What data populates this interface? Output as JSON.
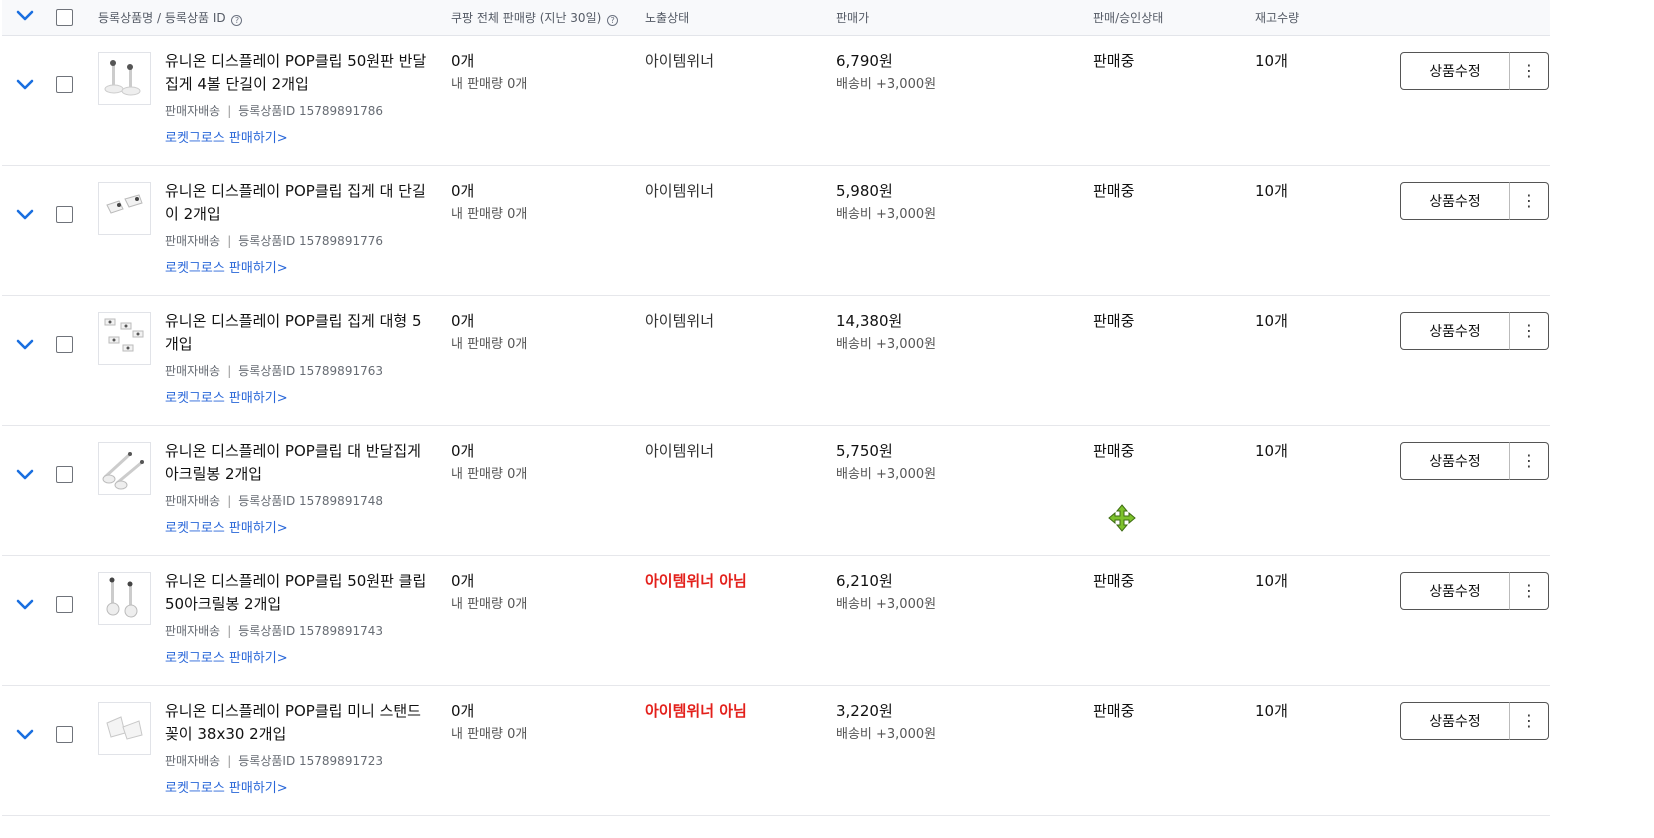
{
  "header": {
    "product_col": "등록상품명 / 등록상품 ID",
    "sales_col": "쿠팡 전체 판매량 (지난 30일)",
    "exposure_col": "노출상태",
    "price_col": "판매가",
    "status_col": "판매/승인상태",
    "stock_col": "재고수량",
    "help_glyph": "?"
  },
  "icons": {
    "expand": "chevron-down-icon",
    "more": "more-vertical-icon",
    "cursor": "move-cursor-icon"
  },
  "colors": {
    "link": "#2866d8",
    "not_winner": "#e3201b"
  },
  "common": {
    "shipping_type": "판매자배송",
    "separator": "|",
    "rocket_growth_link": "로켓그로스 판매하기>",
    "edit_label": "상품수정",
    "more_glyph": "⋮"
  },
  "rows": [
    {
      "name": "유니온 디스플레이 POP클립 50원판 반달집게 4볼 단길이 2개입",
      "reg_id": "등록상품ID 15789891786",
      "sales_total": "0개",
      "my_sales": "내 판매량 0개",
      "exposure": "아이템위너",
      "price": "6,790원",
      "shipping_fee": "배송비 +3,000원",
      "status": "판매중",
      "stock": "10개"
    },
    {
      "name": "유니온 디스플레이 POP클립 집게 대 단길이 2개입",
      "reg_id": "등록상품ID 15789891776",
      "sales_total": "0개",
      "my_sales": "내 판매량 0개",
      "exposure": "아이템위너",
      "price": "5,980원",
      "shipping_fee": "배송비 +3,000원",
      "status": "판매중",
      "stock": "10개"
    },
    {
      "name": "유니온 디스플레이 POP클립 집게 대형 5개입",
      "reg_id": "등록상품ID 15789891763",
      "sales_total": "0개",
      "my_sales": "내 판매량 0개",
      "exposure": "아이템위너",
      "price": "14,380원",
      "shipping_fee": "배송비 +3,000원",
      "status": "판매중",
      "stock": "10개"
    },
    {
      "name": "유니온 디스플레이 POP클립 대 반달집게 아크릴봉 2개입",
      "reg_id": "등록상품ID 15789891748",
      "sales_total": "0개",
      "my_sales": "내 판매량 0개",
      "exposure": "아이템위너",
      "price": "5,750원",
      "shipping_fee": "배송비 +3,000원",
      "status": "판매중",
      "stock": "10개"
    },
    {
      "name": "유니온 디스플레이 POP클립 50원판 클립 50아크릴봉 2개입",
      "reg_id": "등록상품ID 15789891743",
      "sales_total": "0개",
      "my_sales": "내 판매량 0개",
      "exposure": "아이템위너 아님",
      "price": "6,210원",
      "shipping_fee": "배송비 +3,000원",
      "status": "판매중",
      "stock": "10개"
    },
    {
      "name": "유니온 디스플레이 POP클립 미니 스탠드꽂이 38x30 2개입",
      "reg_id": "등록상품ID 15789891723",
      "sales_total": "0개",
      "my_sales": "내 판매량 0개",
      "exposure": "아이템위너 아님",
      "price": "3,220원",
      "shipping_fee": "배송비 +3,000원",
      "status": "판매중",
      "stock": "10개"
    }
  ]
}
